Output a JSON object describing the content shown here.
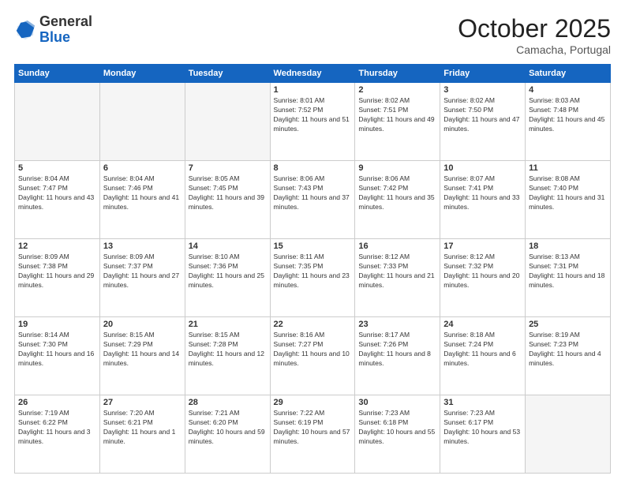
{
  "header": {
    "logo_general": "General",
    "logo_blue": "Blue",
    "month": "October 2025",
    "location": "Camacha, Portugal"
  },
  "days_of_week": [
    "Sunday",
    "Monday",
    "Tuesday",
    "Wednesday",
    "Thursday",
    "Friday",
    "Saturday"
  ],
  "weeks": [
    [
      {
        "day": "",
        "empty": true
      },
      {
        "day": "",
        "empty": true
      },
      {
        "day": "",
        "empty": true
      },
      {
        "day": "1",
        "sunrise": "8:01 AM",
        "sunset": "7:52 PM",
        "daylight": "11 hours and 51 minutes."
      },
      {
        "day": "2",
        "sunrise": "8:02 AM",
        "sunset": "7:51 PM",
        "daylight": "11 hours and 49 minutes."
      },
      {
        "day": "3",
        "sunrise": "8:02 AM",
        "sunset": "7:50 PM",
        "daylight": "11 hours and 47 minutes."
      },
      {
        "day": "4",
        "sunrise": "8:03 AM",
        "sunset": "7:48 PM",
        "daylight": "11 hours and 45 minutes."
      }
    ],
    [
      {
        "day": "5",
        "sunrise": "8:04 AM",
        "sunset": "7:47 PM",
        "daylight": "11 hours and 43 minutes."
      },
      {
        "day": "6",
        "sunrise": "8:04 AM",
        "sunset": "7:46 PM",
        "daylight": "11 hours and 41 minutes."
      },
      {
        "day": "7",
        "sunrise": "8:05 AM",
        "sunset": "7:45 PM",
        "daylight": "11 hours and 39 minutes."
      },
      {
        "day": "8",
        "sunrise": "8:06 AM",
        "sunset": "7:43 PM",
        "daylight": "11 hours and 37 minutes."
      },
      {
        "day": "9",
        "sunrise": "8:06 AM",
        "sunset": "7:42 PM",
        "daylight": "11 hours and 35 minutes."
      },
      {
        "day": "10",
        "sunrise": "8:07 AM",
        "sunset": "7:41 PM",
        "daylight": "11 hours and 33 minutes."
      },
      {
        "day": "11",
        "sunrise": "8:08 AM",
        "sunset": "7:40 PM",
        "daylight": "11 hours and 31 minutes."
      }
    ],
    [
      {
        "day": "12",
        "sunrise": "8:09 AM",
        "sunset": "7:38 PM",
        "daylight": "11 hours and 29 minutes."
      },
      {
        "day": "13",
        "sunrise": "8:09 AM",
        "sunset": "7:37 PM",
        "daylight": "11 hours and 27 minutes."
      },
      {
        "day": "14",
        "sunrise": "8:10 AM",
        "sunset": "7:36 PM",
        "daylight": "11 hours and 25 minutes."
      },
      {
        "day": "15",
        "sunrise": "8:11 AM",
        "sunset": "7:35 PM",
        "daylight": "11 hours and 23 minutes."
      },
      {
        "day": "16",
        "sunrise": "8:12 AM",
        "sunset": "7:33 PM",
        "daylight": "11 hours and 21 minutes."
      },
      {
        "day": "17",
        "sunrise": "8:12 AM",
        "sunset": "7:32 PM",
        "daylight": "11 hours and 20 minutes."
      },
      {
        "day": "18",
        "sunrise": "8:13 AM",
        "sunset": "7:31 PM",
        "daylight": "11 hours and 18 minutes."
      }
    ],
    [
      {
        "day": "19",
        "sunrise": "8:14 AM",
        "sunset": "7:30 PM",
        "daylight": "11 hours and 16 minutes."
      },
      {
        "day": "20",
        "sunrise": "8:15 AM",
        "sunset": "7:29 PM",
        "daylight": "11 hours and 14 minutes."
      },
      {
        "day": "21",
        "sunrise": "8:15 AM",
        "sunset": "7:28 PM",
        "daylight": "11 hours and 12 minutes."
      },
      {
        "day": "22",
        "sunrise": "8:16 AM",
        "sunset": "7:27 PM",
        "daylight": "11 hours and 10 minutes."
      },
      {
        "day": "23",
        "sunrise": "8:17 AM",
        "sunset": "7:26 PM",
        "daylight": "11 hours and 8 minutes."
      },
      {
        "day": "24",
        "sunrise": "8:18 AM",
        "sunset": "7:24 PM",
        "daylight": "11 hours and 6 minutes."
      },
      {
        "day": "25",
        "sunrise": "8:19 AM",
        "sunset": "7:23 PM",
        "daylight": "11 hours and 4 minutes."
      }
    ],
    [
      {
        "day": "26",
        "sunrise": "7:19 AM",
        "sunset": "6:22 PM",
        "daylight": "11 hours and 3 minutes."
      },
      {
        "day": "27",
        "sunrise": "7:20 AM",
        "sunset": "6:21 PM",
        "daylight": "11 hours and 1 minute."
      },
      {
        "day": "28",
        "sunrise": "7:21 AM",
        "sunset": "6:20 PM",
        "daylight": "10 hours and 59 minutes."
      },
      {
        "day": "29",
        "sunrise": "7:22 AM",
        "sunset": "6:19 PM",
        "daylight": "10 hours and 57 minutes."
      },
      {
        "day": "30",
        "sunrise": "7:23 AM",
        "sunset": "6:18 PM",
        "daylight": "10 hours and 55 minutes."
      },
      {
        "day": "31",
        "sunrise": "7:23 AM",
        "sunset": "6:17 PM",
        "daylight": "10 hours and 53 minutes."
      },
      {
        "day": "",
        "empty": true
      }
    ]
  ]
}
